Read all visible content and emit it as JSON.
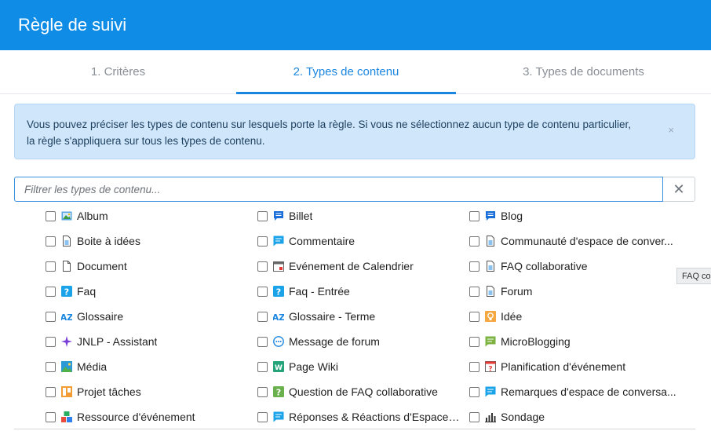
{
  "header": {
    "title": "Règle de suivi"
  },
  "tabs": [
    {
      "label": "1. Critères",
      "active": false
    },
    {
      "label": "2. Types de contenu",
      "active": true
    },
    {
      "label": "3. Types de documents",
      "active": false
    }
  ],
  "info": {
    "line1": "Vous pouvez préciser les types de contenu sur lesquels porte la règle. Si vous ne sélectionnez aucun type de contenu particulier,",
    "line2": "la règle s'appliquera sur tous les types de contenu.",
    "close_symbol": "×"
  },
  "filter": {
    "placeholder": "Filtrer les types de contenu...",
    "value": "",
    "clear_symbol": "✕"
  },
  "columns": [
    [
      {
        "label": "Album",
        "icon": "image-icon",
        "checked": false
      },
      {
        "label": "Boite à idées",
        "icon": "document-lines-icon",
        "checked": false
      },
      {
        "label": "Document",
        "icon": "document-icon",
        "checked": false
      },
      {
        "label": "Faq",
        "icon": "question-icon",
        "checked": false
      },
      {
        "label": "Glossaire",
        "icon": "az-icon",
        "checked": false
      },
      {
        "label": "JNLP - Assistant",
        "icon": "sparkle-icon",
        "checked": false
      },
      {
        "label": "Média",
        "icon": "media-icon",
        "checked": false
      },
      {
        "label": "Projet tâches",
        "icon": "kanban-icon",
        "checked": false
      },
      {
        "label": "Ressource d'événement",
        "icon": "resource-icon",
        "checked": false
      }
    ],
    [
      {
        "label": "Billet",
        "icon": "chat-bubble-icon",
        "checked": false
      },
      {
        "label": "Commentaire",
        "icon": "comment-icon",
        "checked": false
      },
      {
        "label": "Evénement de Calendrier",
        "icon": "calendar-icon",
        "checked": false
      },
      {
        "label": "Faq - Entrée",
        "icon": "question-icon",
        "checked": false
      },
      {
        "label": "Glossaire - Terme",
        "icon": "az-icon",
        "checked": false
      },
      {
        "label": "Message de forum",
        "icon": "forum-message-icon",
        "checked": false
      },
      {
        "label": "Page Wiki",
        "icon": "wiki-icon",
        "checked": false
      },
      {
        "label": "Question de FAQ collaborative",
        "icon": "question-green-icon",
        "checked": false
      },
      {
        "label": "Réponses & Réactions d'Espace d...",
        "icon": "comment-icon",
        "checked": false
      }
    ],
    [
      {
        "label": "Blog",
        "icon": "chat-bubble-icon",
        "checked": false
      },
      {
        "label": "Communauté d'espace de conver...",
        "icon": "document-lines-icon",
        "checked": false
      },
      {
        "label": "FAQ collaborative",
        "icon": "document-lines-icon",
        "checked": false
      },
      {
        "label": "Forum",
        "icon": "document-lines-icon",
        "checked": false
      },
      {
        "label": "Idée",
        "icon": "lightbulb-icon",
        "checked": false
      },
      {
        "label": "MicroBlogging",
        "icon": "microblog-icon",
        "checked": false
      },
      {
        "label": "Planification d'événement",
        "icon": "event-plan-icon",
        "checked": false
      },
      {
        "label": "Remarques d'espace de conversa...",
        "icon": "comment-icon",
        "checked": false
      },
      {
        "label": "Sondage",
        "icon": "poll-icon",
        "checked": false
      }
    ]
  ],
  "tooltip": {
    "text": "FAQ co"
  },
  "colors": {
    "header": "#0f8de6",
    "accent": "#1a86e0",
    "info_bg": "#cfe6fb"
  }
}
